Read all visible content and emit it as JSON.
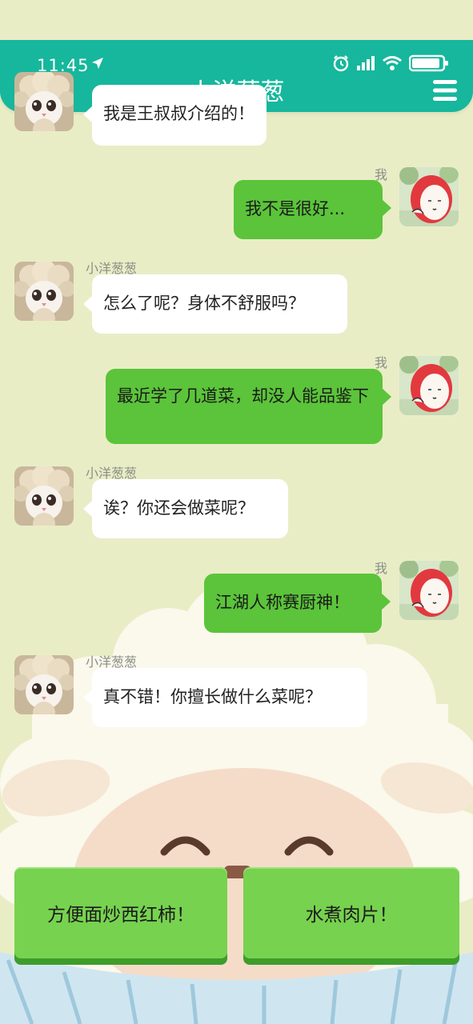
{
  "status_bar": {
    "time": "11:45"
  },
  "header": {
    "title": "小洋葱葱"
  },
  "messages": [
    {
      "side": "left",
      "sender": "",
      "text": "我是王叔叔介绍的！"
    },
    {
      "side": "right",
      "sender": "我",
      "text": "我不是很好..."
    },
    {
      "side": "left",
      "sender": "小洋葱葱",
      "text": "怎么了呢？身体不舒服吗？"
    },
    {
      "side": "right",
      "sender": "我",
      "text": "最近学了几道菜，却没人能品鉴下"
    },
    {
      "side": "left",
      "sender": "小洋葱葱",
      "text": "诶？你还会做菜呢？"
    },
    {
      "side": "right",
      "sender": "我",
      "text": "江湖人称赛厨神！"
    },
    {
      "side": "left",
      "sender": "小洋葱葱",
      "text": "真不错！你擅长做什么菜呢？"
    }
  ],
  "options": [
    {
      "label": "方便面炒西红柿！"
    },
    {
      "label": "水煮肉片！"
    }
  ],
  "colors": {
    "header": "#16b79c",
    "background": "#e9edc6",
    "my_bubble": "#5bc43a",
    "their_bubble": "#ffffff",
    "option_button": "#77d24f"
  }
}
